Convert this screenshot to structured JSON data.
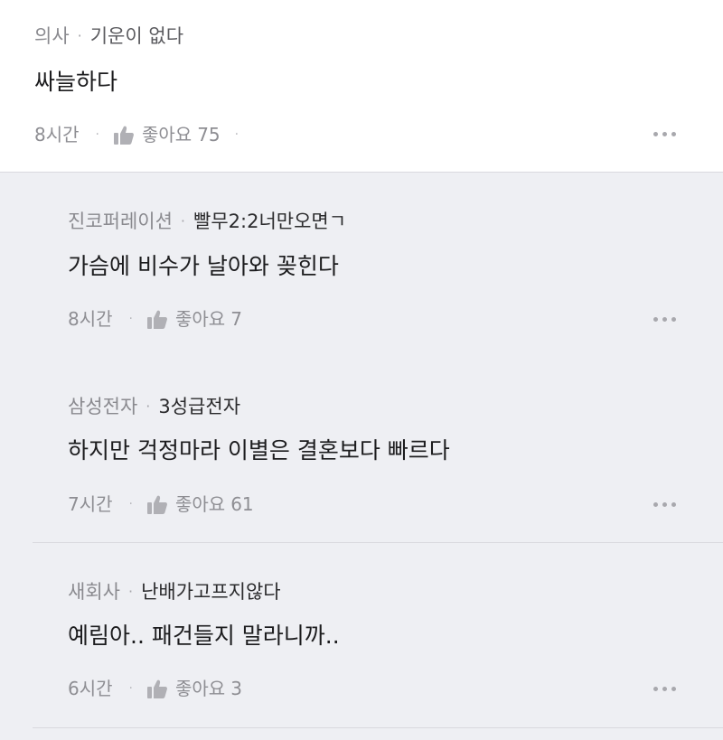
{
  "comments": [
    {
      "company": "의사",
      "nickname": "기운이 없다",
      "text": "싸늘하다",
      "time": "8시간",
      "like_label": "좋아요",
      "like_count": "75"
    },
    {
      "company": "진코퍼레이션",
      "nickname": "빨무2:2너만오면ㄱ",
      "text": "가슴에 비수가 날아와 꽂힌다",
      "time": "8시간",
      "like_label": "좋아요",
      "like_count": "7"
    },
    {
      "company": "삼성전자",
      "nickname": "3성급전자",
      "text": "하지만 걱정마라 이별은 결혼보다 빠르다",
      "time": "7시간",
      "like_label": "좋아요",
      "like_count": "61"
    },
    {
      "company": "새회사",
      "nickname": "난배가고프지않다",
      "text": "예림아.. 패건들지 말라니까..",
      "time": "6시간",
      "like_label": "좋아요",
      "like_count": "3"
    }
  ],
  "separator": "·",
  "icons": {
    "like": "thumbs-up-icon",
    "more": "more-options-icon"
  },
  "colors": {
    "top_bg": "#ffffff",
    "reply_bg": "#eeeff3",
    "meta_gray": "#8e8e93",
    "text": "#1c1c1e"
  }
}
